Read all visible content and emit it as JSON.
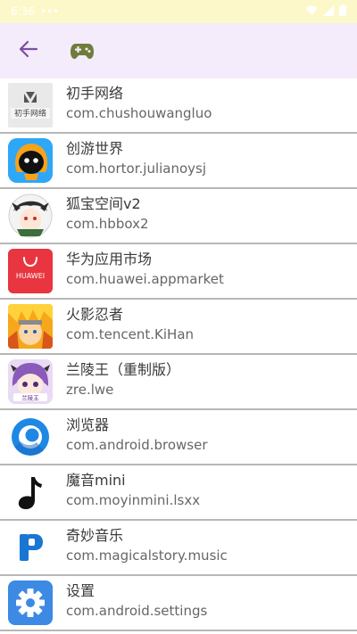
{
  "status_bar": {
    "time": "6:36",
    "dots": "•••"
  },
  "app_bar": {
    "back_icon": "arrow-left-icon",
    "logo_icon": "gamepad-icon",
    "accent_color": "#7a4fa5",
    "background": "#f4ebfb"
  },
  "apps": [
    {
      "name": "初手网络",
      "package": "com.chushouwangluo",
      "icon": "chushou-logo-icon",
      "icon_text": "初手网络"
    },
    {
      "name": "创游世界",
      "package": "com.hortor.julianoysj",
      "icon": "chuangyou-character-icon"
    },
    {
      "name": "狐宝空间v2",
      "package": "com.hbbox2",
      "icon": "anime-avatar-icon"
    },
    {
      "name": "华为应用市场",
      "package": "com.huawei.appmarket",
      "icon": "huawei-appgallery-icon",
      "icon_text": "HUAWEI"
    },
    {
      "name": "火影忍者",
      "package": "com.tencent.KiHan",
      "icon": "naruto-icon"
    },
    {
      "name": "兰陵王（重制版）",
      "package": "zre.lwe",
      "icon": "lanlingwang-icon",
      "icon_text": "兰陵王"
    },
    {
      "name": "浏览器",
      "package": "com.android.browser",
      "icon": "browser-icon"
    },
    {
      "name": "魔音mini",
      "package": "com.moyinmini.lsxx",
      "icon": "music-note-icon"
    },
    {
      "name": "奇妙音乐",
      "package": "com.magicalstory.music",
      "icon": "qimiao-music-icon"
    },
    {
      "name": "设置",
      "package": "com.android.settings",
      "icon": "settings-gear-icon"
    }
  ]
}
